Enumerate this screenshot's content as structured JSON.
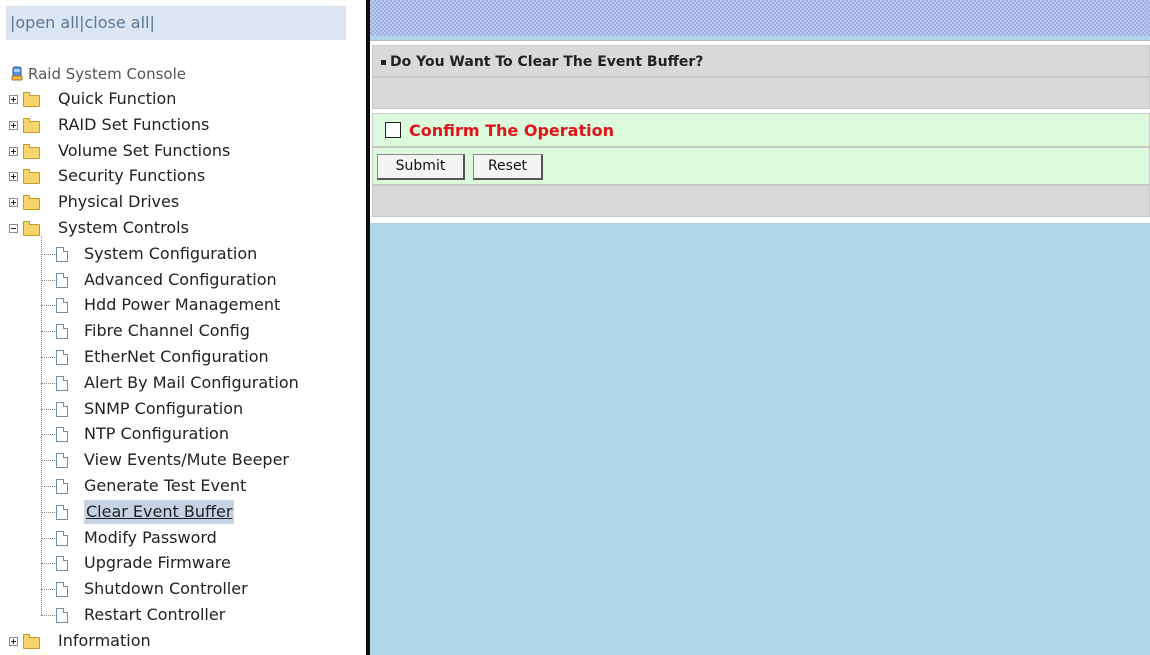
{
  "topbar": {
    "separator": "|",
    "open_all": "open all",
    "close_all": "close all"
  },
  "tree": {
    "root_label": "Raid System Console",
    "folders": [
      {
        "label": "Quick Function",
        "expanded": false
      },
      {
        "label": "RAID Set Functions",
        "expanded": false
      },
      {
        "label": "Volume Set Functions",
        "expanded": false
      },
      {
        "label": "Security Functions",
        "expanded": false
      },
      {
        "label": "Physical Drives",
        "expanded": false
      },
      {
        "label": "System Controls",
        "expanded": true
      },
      {
        "label": "Information",
        "expanded": false
      }
    ],
    "system_controls_items": [
      "System Configuration",
      "Advanced Configuration",
      "Hdd Power Management",
      "Fibre Channel Config",
      "EtherNet Configuration",
      "Alert By Mail Configuration",
      "SNMP Configuration",
      "NTP Configuration",
      "View Events/Mute Beeper",
      "Generate Test Event",
      "Clear Event Buffer",
      "Modify Password",
      "Upgrade Firmware",
      "Shutdown Controller",
      "Restart Controller"
    ],
    "selected_item": "Clear Event Buffer"
  },
  "form": {
    "question": "Do You Want To Clear The Event Buffer?",
    "confirm_label": "Confirm The Operation",
    "confirm_checked": false,
    "submit_label": "Submit",
    "reset_label": "Reset"
  },
  "colors": {
    "content_bg": "#b0d6e7",
    "confirm_text": "#e2131a",
    "confirm_row_bg": "#dcfadc",
    "header_row_bg": "#d9d9d9",
    "topbar_bg": "#dbe6f2",
    "selected_bg": "#c6d3e4"
  }
}
